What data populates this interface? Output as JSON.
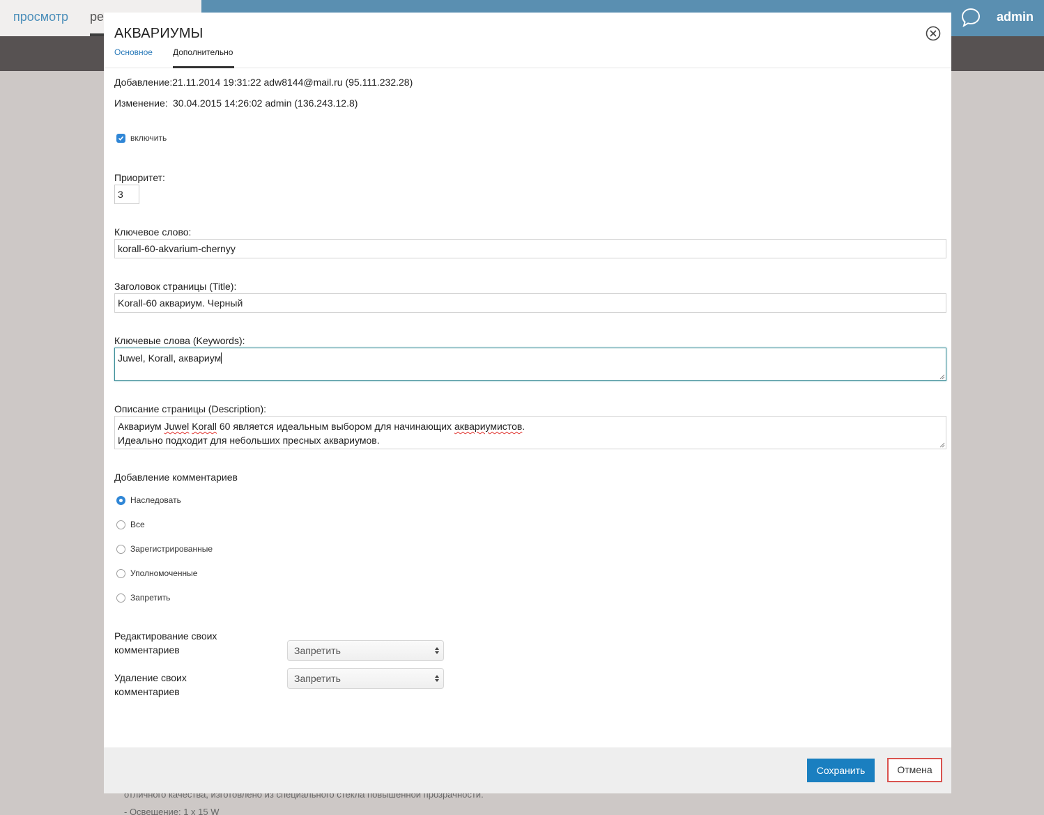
{
  "background": {
    "nav_view": "просмотр",
    "nav_edit": "ре",
    "user": "admin",
    "text_line1": "отличного качества, изготовлено из специального стекла повышенной прозрачности.",
    "text_line2": "- Освещение: 1 x 15 W"
  },
  "modal": {
    "title": "АКВАРИУМЫ",
    "tabs": [
      {
        "label": "Основное",
        "active": false
      },
      {
        "label": "Дополнительно",
        "active": true
      }
    ],
    "info": {
      "added_label": "Добавление:",
      "added_value": "21.11.2014 19:31:22 adw8144@mail.ru (95.111.232.28)",
      "modified_label": "Изменение:",
      "modified_value": "30.04.2015 14:26:02 admin (136.243.12.8)"
    },
    "enable": {
      "label": "включить",
      "checked": true
    },
    "priority": {
      "label": "Приоритет:",
      "value": "3"
    },
    "keyword": {
      "label": "Ключевое слово:",
      "value": "korall-60-akvarium-chernyy"
    },
    "page_title": {
      "label": "Заголовок страницы (Title):",
      "value": "Korall-60 аквариум. Черный"
    },
    "keywords": {
      "label": "Ключевые слова (Keywords):",
      "value": "Juwel, Korall, аквариум"
    },
    "description": {
      "label": "Описание страницы (Description):",
      "line1_a": "Аквариум ",
      "line1_w1": "Juwel",
      "line1_sp": " ",
      "line1_w2": "Korall",
      "line1_b": " 60 является идеальным выбором для начинающих ",
      "line1_w3": "аквариумистов",
      "line1_c": ".",
      "line2": "Идеально подходит для небольших пресных аквариумов."
    },
    "comments": {
      "label": "Добавление комментариев",
      "options": [
        "Наследовать",
        "Все",
        "Зарегистрированные",
        "Уполномоченные",
        "Запретить"
      ],
      "selected": "Наследовать"
    },
    "edit_own": {
      "label": "Редактирование своих комментариев",
      "value": "Запретить"
    },
    "delete_own": {
      "label": "Удаление своих комментариев",
      "value": "Запретить"
    },
    "save_label": "Сохранить",
    "cancel_label": "Отмена"
  },
  "colors": {
    "accent": "#1a7fc0",
    "topbar": "#5a8fb1",
    "cancel_border": "#d9534f"
  }
}
